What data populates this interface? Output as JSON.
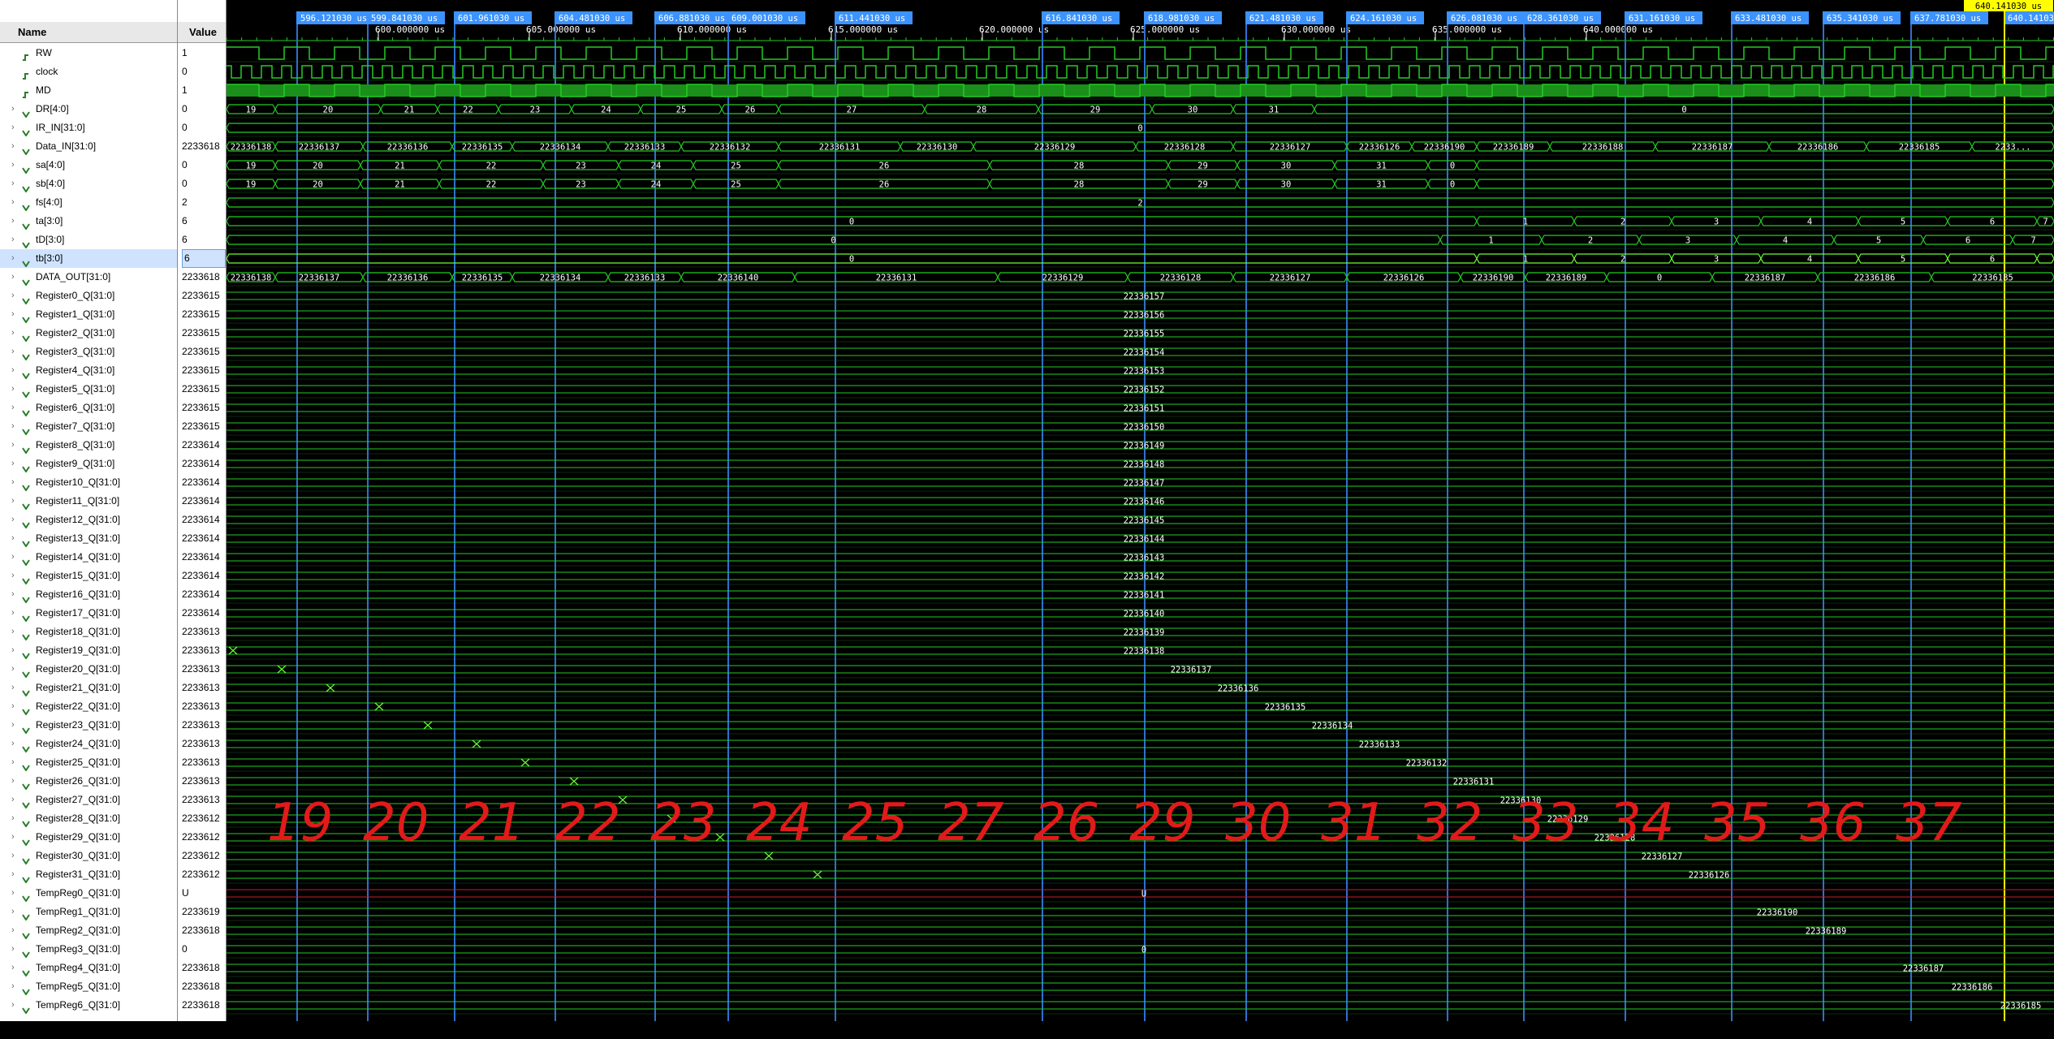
{
  "columns": {
    "name": "Name",
    "value": "Value"
  },
  "signals": [
    {
      "name": "RW",
      "value": "1",
      "kind": "bit"
    },
    {
      "name": "clock",
      "value": "0",
      "kind": "bit"
    },
    {
      "name": "MD",
      "value": "1",
      "kind": "bit"
    },
    {
      "name": "DR[4:0]",
      "value": "0",
      "kind": "bus"
    },
    {
      "name": "IR_IN[31:0]",
      "value": "0",
      "kind": "bus"
    },
    {
      "name": "Data_IN[31:0]",
      "value": "2233618",
      "kind": "bus"
    },
    {
      "name": "sa[4:0]",
      "value": "0",
      "kind": "bus"
    },
    {
      "name": "sb[4:0]",
      "value": "0",
      "kind": "bus"
    },
    {
      "name": "fs[4:0]",
      "value": "2",
      "kind": "bus"
    },
    {
      "name": "ta[3:0]",
      "value": "6",
      "kind": "bus"
    },
    {
      "name": "tD[3:0]",
      "value": "6",
      "kind": "bus"
    },
    {
      "name": "tb[3:0]",
      "value": "6",
      "kind": "bus",
      "selected": true
    },
    {
      "name": "DATA_OUT[31:0]",
      "value": "2233618",
      "kind": "bus"
    },
    {
      "name": "Register0_Q[31:0]",
      "value": "2233615",
      "kind": "bus"
    },
    {
      "name": "Register1_Q[31:0]",
      "value": "2233615",
      "kind": "bus"
    },
    {
      "name": "Register2_Q[31:0]",
      "value": "2233615",
      "kind": "bus"
    },
    {
      "name": "Register3_Q[31:0]",
      "value": "2233615",
      "kind": "bus"
    },
    {
      "name": "Register4_Q[31:0]",
      "value": "2233615",
      "kind": "bus"
    },
    {
      "name": "Register5_Q[31:0]",
      "value": "2233615",
      "kind": "bus"
    },
    {
      "name": "Register6_Q[31:0]",
      "value": "2233615",
      "kind": "bus"
    },
    {
      "name": "Register7_Q[31:0]",
      "value": "2233615",
      "kind": "bus"
    },
    {
      "name": "Register8_Q[31:0]",
      "value": "2233614",
      "kind": "bus"
    },
    {
      "name": "Register9_Q[31:0]",
      "value": "2233614",
      "kind": "bus"
    },
    {
      "name": "Register10_Q[31:0]",
      "value": "2233614",
      "kind": "bus"
    },
    {
      "name": "Register11_Q[31:0]",
      "value": "2233614",
      "kind": "bus"
    },
    {
      "name": "Register12_Q[31:0]",
      "value": "2233614",
      "kind": "bus"
    },
    {
      "name": "Register13_Q[31:0]",
      "value": "2233614",
      "kind": "bus"
    },
    {
      "name": "Register14_Q[31:0]",
      "value": "2233614",
      "kind": "bus"
    },
    {
      "name": "Register15_Q[31:0]",
      "value": "2233614",
      "kind": "bus"
    },
    {
      "name": "Register16_Q[31:0]",
      "value": "2233614",
      "kind": "bus"
    },
    {
      "name": "Register17_Q[31:0]",
      "value": "2233614",
      "kind": "bus"
    },
    {
      "name": "Register18_Q[31:0]",
      "value": "2233613",
      "kind": "bus"
    },
    {
      "name": "Register19_Q[31:0]",
      "value": "2233613",
      "kind": "bus"
    },
    {
      "name": "Register20_Q[31:0]",
      "value": "2233613",
      "kind": "bus"
    },
    {
      "name": "Register21_Q[31:0]",
      "value": "2233613",
      "kind": "bus"
    },
    {
      "name": "Register22_Q[31:0]",
      "value": "2233613",
      "kind": "bus"
    },
    {
      "name": "Register23_Q[31:0]",
      "value": "2233613",
      "kind": "bus"
    },
    {
      "name": "Register24_Q[31:0]",
      "value": "2233613",
      "kind": "bus"
    },
    {
      "name": "Register25_Q[31:0]",
      "value": "2233613",
      "kind": "bus"
    },
    {
      "name": "Register26_Q[31:0]",
      "value": "2233613",
      "kind": "bus"
    },
    {
      "name": "Register27_Q[31:0]",
      "value": "2233613",
      "kind": "bus"
    },
    {
      "name": "Register28_Q[31:0]",
      "value": "2233612",
      "kind": "bus"
    },
    {
      "name": "Register29_Q[31:0]",
      "value": "2233612",
      "kind": "bus"
    },
    {
      "name": "Register30_Q[31:0]",
      "value": "2233612",
      "kind": "bus"
    },
    {
      "name": "Register31_Q[31:0]",
      "value": "2233612",
      "kind": "bus"
    },
    {
      "name": "TempReg0_Q[31:0]",
      "value": "U",
      "kind": "bus"
    },
    {
      "name": "TempReg1_Q[31:0]",
      "value": "2233619",
      "kind": "bus"
    },
    {
      "name": "TempReg2_Q[31:0]",
      "value": "2233618",
      "kind": "bus"
    },
    {
      "name": "TempReg3_Q[31:0]",
      "value": "0",
      "kind": "bus"
    },
    {
      "name": "TempReg4_Q[31:0]",
      "value": "2233618",
      "kind": "bus"
    },
    {
      "name": "TempReg5_Q[31:0]",
      "value": "2233618",
      "kind": "bus"
    },
    {
      "name": "TempReg6_Q[31:0]",
      "value": "2233618",
      "kind": "bus"
    }
  ],
  "timeline": {
    "major_ticks": [
      "600.000000 us",
      "605.000000 us",
      "610.000000 us",
      "615.000000 us",
      "620.000000 us",
      "625.000000 us",
      "630.000000 us",
      "635.000000 us",
      "640.000000 us"
    ],
    "markers": [
      "596.121030 us",
      "599.841030 us",
      "601.961030 us",
      "604.481030 us",
      "606.881030 us",
      "609.001030 us",
      "611.441030 us",
      "616.841030 us",
      "618.981030 us",
      "621.481030 us",
      "624.161030 us",
      "626.081030 us",
      "628.361030 us",
      "631.161030 us",
      "633.481030 us",
      "635.341030 us",
      "637.781030 us",
      "640.141030 us"
    ],
    "cursor_label": "640.141030 us"
  },
  "bus_labels": {
    "DR": [
      "19",
      "20",
      "21",
      "22",
      "23",
      "24",
      "25",
      "26",
      "27",
      "28",
      "29",
      "30",
      "31",
      "0"
    ],
    "IR_IN": [
      "0"
    ],
    "Data_IN": [
      "22336138",
      "22336137",
      "22336136",
      "22336135",
      "22336134",
      "22336133",
      "22336132",
      "22336131",
      "22336130",
      "22336129",
      "22336128",
      "22336127",
      "22336126",
      "22336190",
      "22336189",
      "22336188",
      "22336187",
      "22336186",
      "22336185",
      "2233..."
    ],
    "sa": [
      "19",
      "20",
      "21",
      "22",
      "23",
      "24",
      "25",
      "26",
      "28",
      "29",
      "30",
      "31",
      "0"
    ],
    "sb": [
      "19",
      "20",
      "21",
      "22",
      "23",
      "24",
      "25",
      "26",
      "28",
      "29",
      "30",
      "31",
      "0"
    ],
    "fs": [
      "2"
    ],
    "ta": [
      "0",
      "1",
      "2",
      "3",
      "4",
      "5",
      "6",
      "7"
    ],
    "tD": [
      "0",
      "1",
      "2",
      "3",
      "4",
      "5",
      "6",
      "7"
    ],
    "tb": [
      "0",
      "1",
      "2",
      "3",
      "4",
      "5",
      "6"
    ],
    "DATA_OUT": [
      "22336138",
      "22336137",
      "22336136",
      "22336135",
      "22336134",
      "22336133",
      "22336140",
      "22336131",
      "22336129",
      "22336128",
      "22336127",
      "22336126",
      "22336190",
      "22336189",
      "0",
      "22336187",
      "22336186",
      "22336185"
    ],
    "registers": [
      "22336157",
      "22336156",
      "22336155",
      "22336154",
      "22336153",
      "22336152",
      "22336151",
      "22336150",
      "22336149",
      "22336148",
      "22336147",
      "22336146",
      "22336145",
      "22336144",
      "22336143",
      "22336142",
      "22336141",
      "22336140",
      "22336139",
      "22336138",
      "22336137",
      "22336136",
      "22336135",
      "22336134",
      "22336133",
      "22336132",
      "22336131",
      "22336130",
      "22336129",
      "22336128",
      "22336127",
      "22336126"
    ],
    "tempregs": [
      "U",
      "22336190",
      "22336189",
      "0",
      "22336187",
      "22336186",
      "22336185"
    ]
  },
  "annotations": [
    "19",
    "20",
    "21",
    "22",
    "23",
    "24",
    "25",
    "27",
    "26",
    "29",
    "30",
    "31",
    "32",
    "33",
    "34",
    "35",
    "36",
    "37"
  ],
  "colors": {
    "wave": "#22cc22",
    "bright": "#66ff33",
    "marker": "#2f6fd0",
    "cursor": "#ffff00",
    "annot": "#e21a1a",
    "label": "#3c93ff"
  }
}
